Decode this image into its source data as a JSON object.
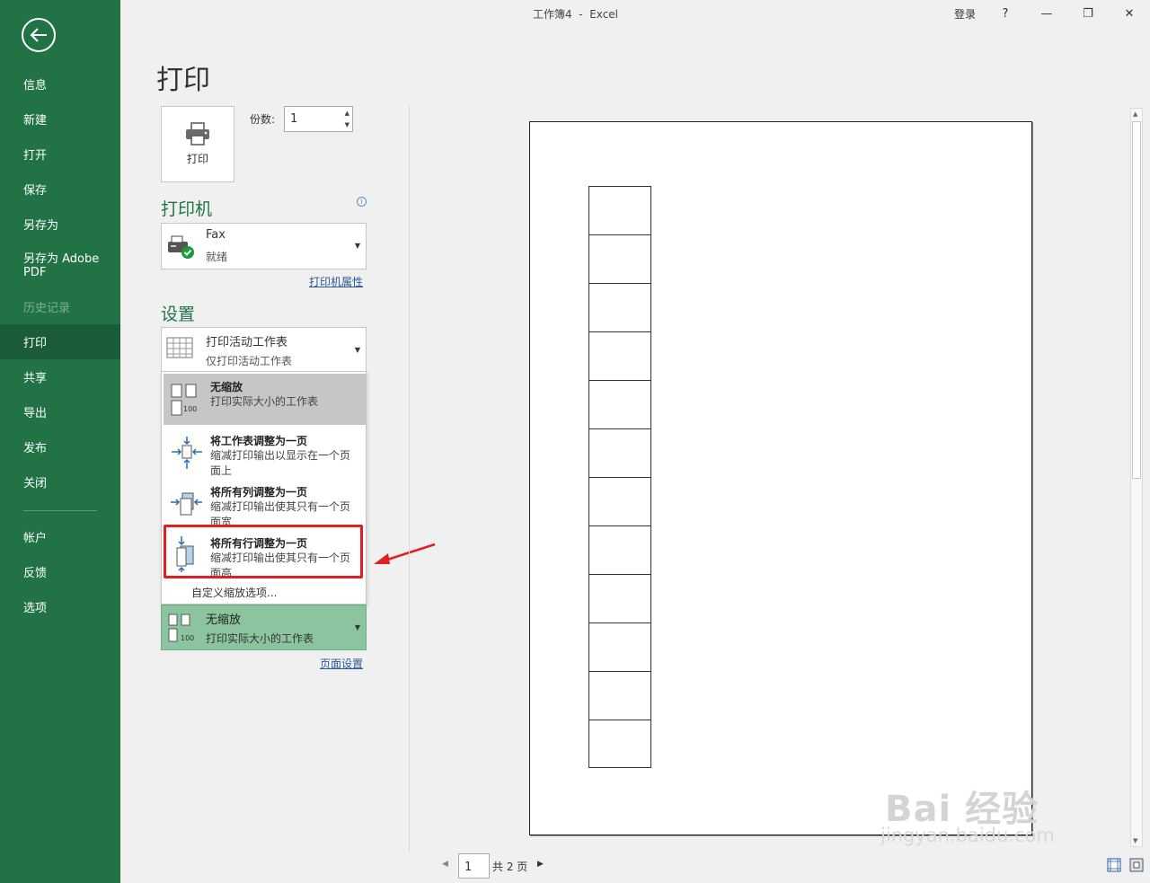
{
  "window": {
    "title": "工作簿4  -  Excel",
    "signin": "登录",
    "help": "?",
    "minimize": "—",
    "restore": "❐",
    "close": "✕"
  },
  "sidebar": {
    "items": [
      {
        "label": "信息"
      },
      {
        "label": "新建"
      },
      {
        "label": "打开"
      },
      {
        "label": "保存"
      },
      {
        "label": "另存为"
      },
      {
        "label": "另存为 Adobe PDF"
      },
      {
        "label": "历史记录"
      },
      {
        "label": "打印"
      },
      {
        "label": "共享"
      },
      {
        "label": "导出"
      },
      {
        "label": "发布"
      },
      {
        "label": "关闭"
      },
      {
        "label": "帐户"
      },
      {
        "label": "反馈"
      },
      {
        "label": "选项"
      }
    ]
  },
  "print": {
    "title": "打印",
    "button_label": "打印",
    "copies_label": "份数:",
    "copies_value": "1",
    "printer_heading": "打印机",
    "printer_name": "Fax",
    "printer_status": "就绪",
    "printer_props_link": "打印机属性",
    "settings_heading": "设置",
    "what_main": "打印活动工作表",
    "what_sub": "仅打印活动工作表",
    "scaling_menu": {
      "items": [
        {
          "title": "无缩放",
          "desc": "打印实际大小的工作表"
        },
        {
          "title": "将工作表调整为一页",
          "desc": "缩减打印输出以显示在一个页面上"
        },
        {
          "title": "将所有列调整为一页",
          "desc": "缩减打印输出使其只有一个页面宽"
        },
        {
          "title": "将所有行调整为一页",
          "desc": "缩减打印输出使其只有一个页面高"
        }
      ],
      "custom": "自定义缩放选项..."
    },
    "scaling_selected_main": "无缩放",
    "scaling_selected_sub": "打印实际大小的工作表",
    "page_setup_link": "页面设置",
    "badge_100": "100"
  },
  "preview": {
    "current_page": "1",
    "total_pages": "共 2 页",
    "rows": 12
  },
  "watermark": {
    "text_big": "Bai 经验",
    "text_small": "jingyan.baidu.com"
  },
  "colors": {
    "accent": "#217346",
    "highlight": "#e02020"
  }
}
